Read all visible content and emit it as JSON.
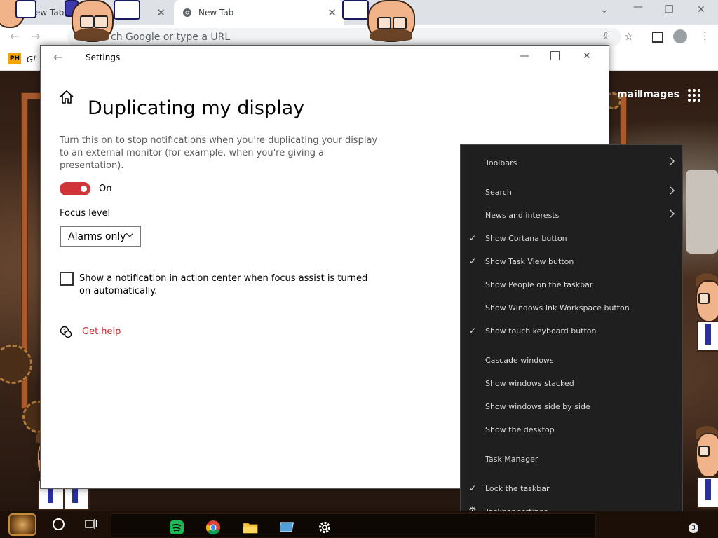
{
  "browser": {
    "tabs": [
      {
        "label": "ew Tab"
      },
      {
        "label": "New Tab"
      }
    ],
    "omnibox_placeholder": "ch Google or type a URL",
    "bookmark_badge": "PH",
    "bookmark_text": "Gi",
    "google_links": [
      "mail",
      "Images"
    ]
  },
  "settings": {
    "window_title": "Settings",
    "page_heading": "Duplicating my display",
    "description": "Turn this on to stop notifications when you're duplicating your display to an external monitor (for example, when you're giving a presentation).",
    "toggle_label": "On",
    "toggle_state": "on",
    "focus_level_label": "Focus level",
    "focus_level_value": "Alarms only",
    "checkbox_label": "Show a notification in action center when focus assist is turned on automatically.",
    "checkbox_checked": false,
    "help_link": "Get help",
    "accent_color": "#d13438"
  },
  "context_menu": {
    "items": [
      {
        "label": "Toolbars",
        "checked": false,
        "submenu": true
      },
      {
        "label": "Search",
        "checked": false,
        "submenu": true
      },
      {
        "label": "News and interests",
        "checked": false,
        "submenu": true
      },
      {
        "label": "Show Cortana button",
        "checked": true,
        "submenu": false
      },
      {
        "label": "Show Task View button",
        "checked": true,
        "submenu": false
      },
      {
        "label": "Show People on the taskbar",
        "checked": false,
        "submenu": false
      },
      {
        "label": "Show Windows Ink Workspace button",
        "checked": false,
        "submenu": false
      },
      {
        "label": "Show touch keyboard button",
        "checked": true,
        "submenu": false
      },
      {
        "label": "Cascade windows",
        "checked": false,
        "submenu": false
      },
      {
        "label": "Show windows stacked",
        "checked": false,
        "submenu": false
      },
      {
        "label": "Show windows side by side",
        "checked": false,
        "submenu": false
      },
      {
        "label": "Show the desktop",
        "checked": false,
        "submenu": false
      },
      {
        "label": "Task Manager",
        "checked": false,
        "submenu": false
      },
      {
        "label": "Lock the taskbar",
        "checked": true,
        "submenu": false
      },
      {
        "label": "Taskbar settings",
        "checked": false,
        "submenu": false,
        "icon": "gear-icon"
      }
    ]
  },
  "taskbar": {
    "notification_count": "3",
    "apps": [
      "start-orb",
      "cortana-icon",
      "task-view-icon",
      "spotify-icon",
      "chrome-icon",
      "file-explorer-icon",
      "remote-desktop-icon",
      "settings-gear-icon"
    ]
  }
}
